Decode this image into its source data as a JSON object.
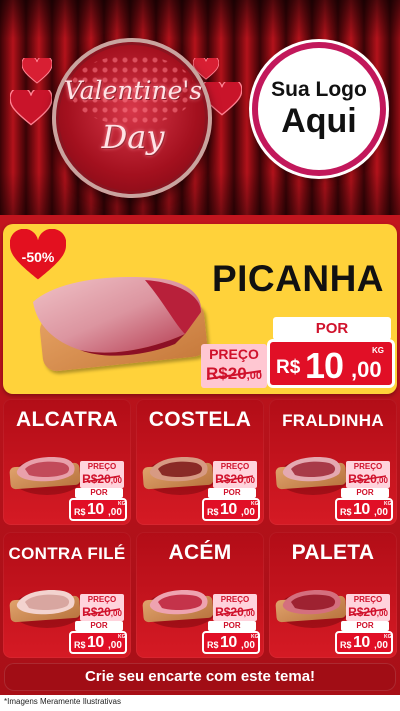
{
  "header": {
    "theme_line1": "Valentine's",
    "theme_line2": "Day",
    "logo_line1": "Sua Logo",
    "logo_line2": "Aqui"
  },
  "featured": {
    "name": "PICANHA",
    "discount": "-50%",
    "preco_label": "PREÇO",
    "old_price_int": "R$20",
    "old_price_dec": ",00",
    "por_label": "POR",
    "currency": "R$",
    "price_int": "10",
    "price_dec": ",00",
    "unit": "KG"
  },
  "products": [
    {
      "name": "ALCATRA",
      "preco_label": "PREÇO",
      "old_price_int": "R$20",
      "old_price_dec": ",00",
      "por_label": "POR",
      "currency": "R$",
      "price_int": "10",
      "price_dec": ",00",
      "unit": "KG"
    },
    {
      "name": "COSTELA",
      "preco_label": "PREÇO",
      "old_price_int": "R$20",
      "old_price_dec": ",00",
      "por_label": "POR",
      "currency": "R$",
      "price_int": "10",
      "price_dec": ",00",
      "unit": "KG"
    },
    {
      "name": "FRALDINHA",
      "preco_label": "PREÇO",
      "old_price_int": "R$20",
      "old_price_dec": ",00",
      "por_label": "POR",
      "currency": "R$",
      "price_int": "10",
      "price_dec": ",00",
      "unit": "KG"
    },
    {
      "name": "CONTRA FILÉ",
      "preco_label": "PREÇO",
      "old_price_int": "R$20",
      "old_price_dec": ",00",
      "por_label": "POR",
      "currency": "R$",
      "price_int": "10",
      "price_dec": ",00",
      "unit": "KG"
    },
    {
      "name": "ACÉM",
      "preco_label": "PREÇO",
      "old_price_int": "R$20",
      "old_price_dec": ",00",
      "por_label": "POR",
      "currency": "R$",
      "price_int": "10",
      "price_dec": ",00",
      "unit": "KG"
    },
    {
      "name": "PALETA",
      "preco_label": "PREÇO",
      "old_price_int": "R$20",
      "old_price_dec": ",00",
      "por_label": "POR",
      "currency": "R$",
      "price_int": "10",
      "price_dec": ",00",
      "unit": "KG"
    }
  ],
  "cta": "Crie seu encarte com este tema!",
  "footnote": "*Imagens Meramente Ilustrativas",
  "colors": {
    "primary_red": "#c2151e",
    "feature_yellow": "#ffd23a",
    "price_red": "#e10f26",
    "preco_pink": "#ffc7d2",
    "logo_border": "#c2185b"
  },
  "icons": [
    "heart-icon",
    "meat-image",
    "cutting-board"
  ]
}
